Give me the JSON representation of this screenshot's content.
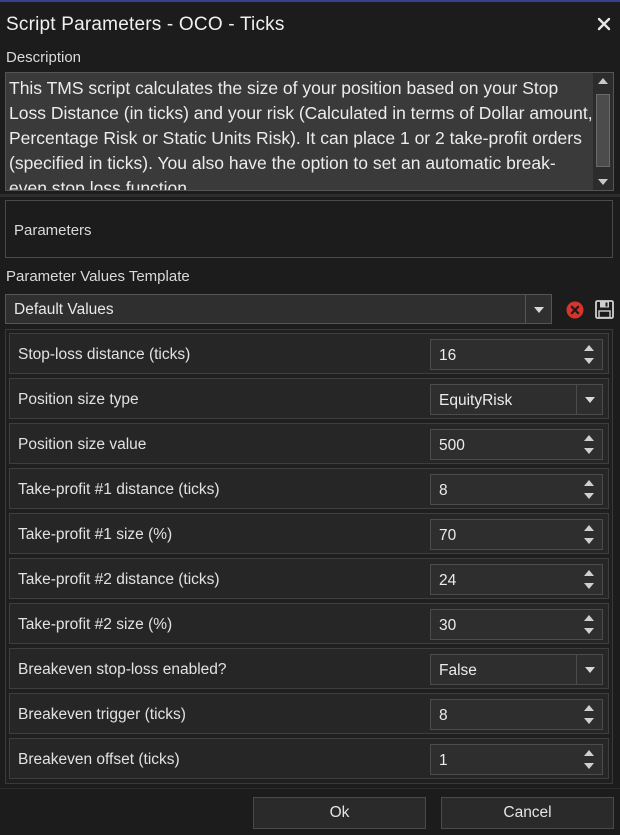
{
  "window": {
    "title": "Script Parameters - OCO - Ticks"
  },
  "description": {
    "label": "Description",
    "text": "This TMS script calculates the size of your position based on your Stop Loss Distance (in ticks) and your risk (Calculated in terms of Dollar amount, Percentage Risk or Static Units Risk). It can place 1 or 2 take-profit orders (specified in ticks). You also have the option to set an automatic break-even stop loss function."
  },
  "parameters_section": {
    "label": "Parameters"
  },
  "template": {
    "label": "Parameter Values Template",
    "selected": "Default Values"
  },
  "params": [
    {
      "label": "Stop-loss distance (ticks)",
      "value": "16",
      "control": "spinner"
    },
    {
      "label": "Position size type",
      "value": "EquityRisk",
      "control": "select"
    },
    {
      "label": "Position size value",
      "value": "500",
      "control": "spinner"
    },
    {
      "label": "Take-profit #1 distance (ticks)",
      "value": "8",
      "control": "spinner"
    },
    {
      "label": "Take-profit #1 size (%)",
      "value": "70",
      "control": "spinner"
    },
    {
      "label": "Take-profit #2 distance (ticks)",
      "value": "24",
      "control": "spinner"
    },
    {
      "label": "Take-profit #2 size (%)",
      "value": "30",
      "control": "spinner"
    },
    {
      "label": "Breakeven stop-loss enabled?",
      "value": "False",
      "control": "select"
    },
    {
      "label": "Breakeven trigger (ticks)",
      "value": "8",
      "control": "spinner"
    },
    {
      "label": "Breakeven offset (ticks)",
      "value": "1",
      "control": "spinner"
    }
  ],
  "buttons": {
    "ok": "Ok",
    "cancel": "Cancel"
  },
  "icons": {
    "close": "close-icon",
    "delete": "delete-icon",
    "save": "save-icon"
  },
  "colors": {
    "accent_border": "#3a3f8c",
    "delete_red": "#d9342b"
  }
}
